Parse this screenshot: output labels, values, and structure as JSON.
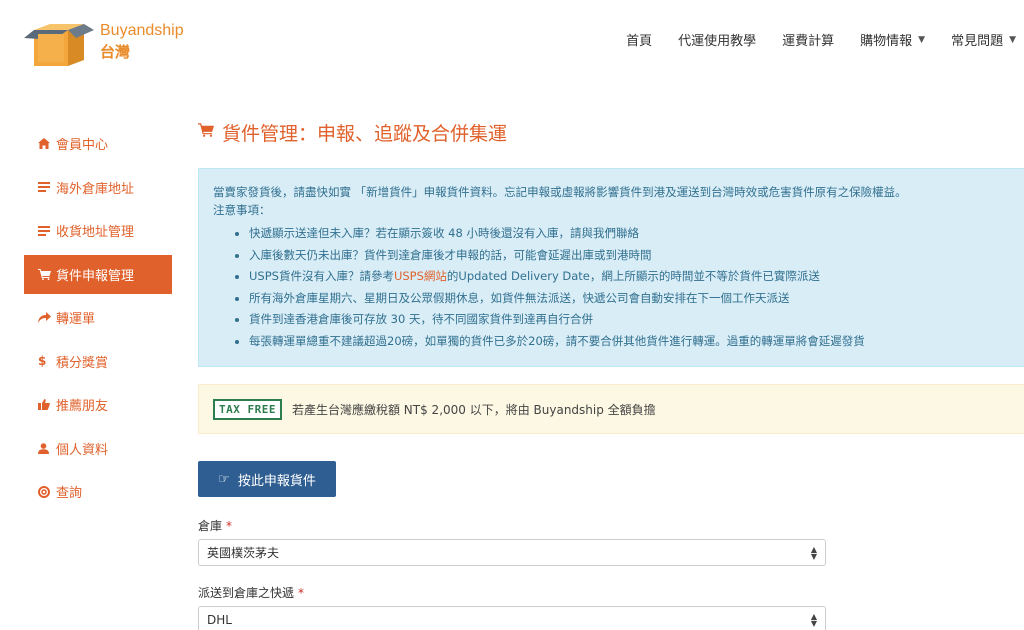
{
  "header": {
    "brand": "Buyandship",
    "brand_sub": "台灣",
    "nav": [
      {
        "label": "首頁",
        "dropdown": false
      },
      {
        "label": "代運使用教學",
        "dropdown": false
      },
      {
        "label": "運費計算",
        "dropdown": false
      },
      {
        "label": "購物情報",
        "dropdown": true
      },
      {
        "label": "常見問題",
        "dropdown": true
      }
    ]
  },
  "sidebar": {
    "items": [
      {
        "label": "會員中心",
        "icon": "home-icon"
      },
      {
        "label": "海外倉庫地址",
        "icon": "list-icon"
      },
      {
        "label": "收貨地址管理",
        "icon": "list-icon"
      },
      {
        "label": "貨件申報管理",
        "icon": "cart-icon",
        "active": true
      },
      {
        "label": "轉運單",
        "icon": "share-icon"
      },
      {
        "label": "積分獎賞",
        "icon": "dollar-icon"
      },
      {
        "label": "推薦朋友",
        "icon": "thumbs-up-icon"
      },
      {
        "label": "個人資料",
        "icon": "user-icon"
      },
      {
        "label": "查詢",
        "icon": "lifebuoy-icon"
      }
    ]
  },
  "main": {
    "title": "貨件管理：申報、追蹤及合併集運",
    "info": {
      "intro": "當賣家發貨後，請盡快如實 「新增貨件」申報貨件資料。忘記申報或虛報將影響貨件到港及運送到台灣時效或危害貨件原有之保險權益。",
      "notes_heading": "注意事項：",
      "notes": [
        "快遞顯示送達但未入庫？若在顯示簽收 48 小時後還沒有入庫，請與我們聯絡",
        "入庫後數天仍未出庫？貨件到達倉庫後才申報的話，可能會延遲出庫或到港時間",
        "所有海外倉庫星期六、星期日及公眾假期休息，如貨件無法派送，快遞公司會自動安排在下一個工作天派送",
        "貨件到達香港倉庫後可存放 30 天，待不同國家貨件到達再自行合併",
        "每張轉運單總重不建議超過20磅，如單獨的貨件已多於20磅，請不要合併其他貨件進行轉運。過重的轉運單將會延遲發貨"
      ],
      "usps_pre": "USPS貨件沒有入庫？請參考",
      "usps_link": "USPS網站",
      "usps_post": "的Updated Delivery Date，網上所顯示的時間並不等於貨件已實際派送"
    },
    "tax": {
      "badge": "TAX FREE",
      "text": "若產生台灣應繳稅額 NT$ 2,000 以下，將由 Buyandship 全額負擔"
    },
    "declare_button": "按此申報貨件",
    "form": {
      "warehouse_label": "倉庫",
      "warehouse_value": "英國樸茨茅夫",
      "courier_label": "派送到倉庫之快遞",
      "courier_value": "DHL",
      "required_mark": "*"
    }
  },
  "colors": {
    "accent": "#e0612b",
    "primary_button": "#2f5f92",
    "info_bg": "#d9edf7",
    "info_text": "#31708f",
    "warning_bg": "#fcf8e3"
  }
}
